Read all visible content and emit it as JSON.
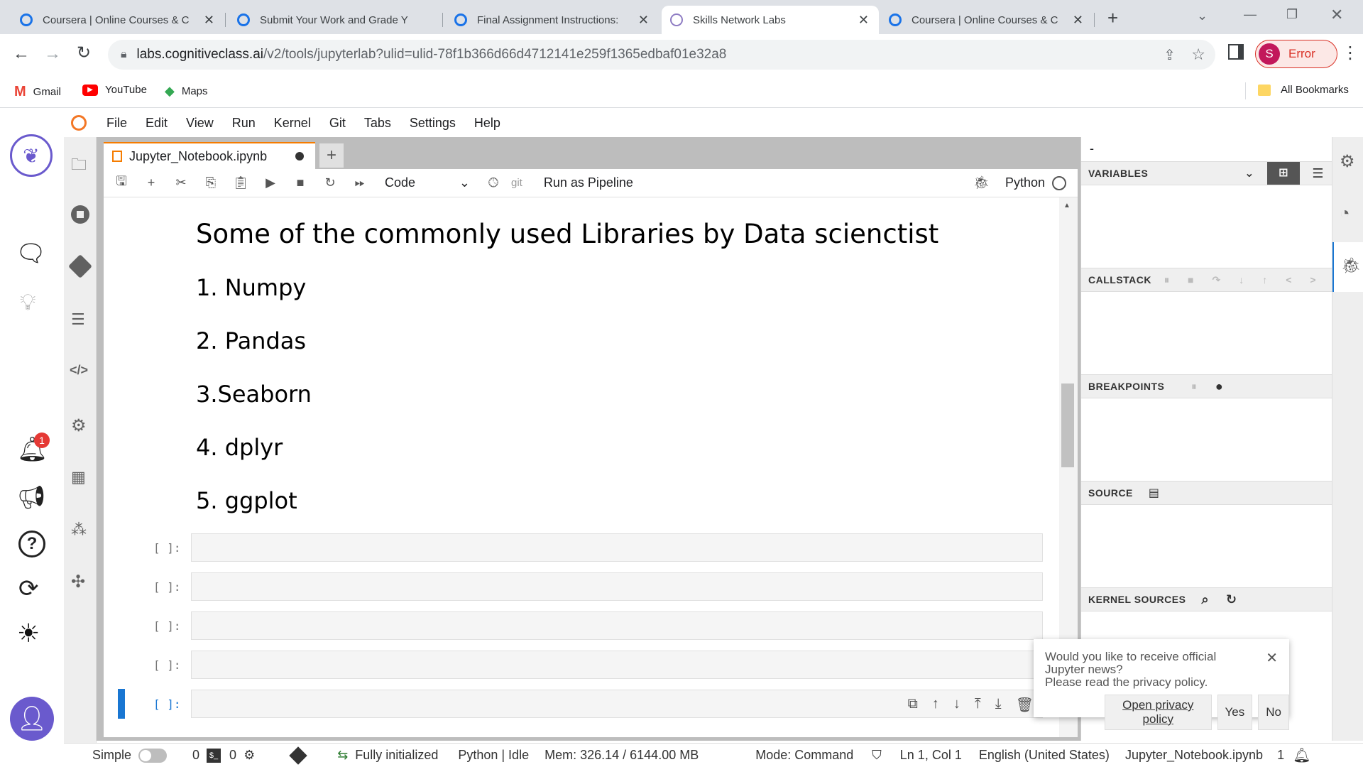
{
  "browser": {
    "tabs": [
      {
        "title": "Coursera | Online Courses & C",
        "active": false
      },
      {
        "title": "Submit Your Work and Grade Y",
        "active": false
      },
      {
        "title": "Final Assignment Instructions:",
        "active": false
      },
      {
        "title": "Skills Network Labs",
        "active": true
      },
      {
        "title": "Coursera | Online Courses & C",
        "active": false
      }
    ],
    "url_host": "labs.cognitiveclass.ai",
    "url_path": "/v2/tools/jupyterlab?ulid=ulid-78f1b366d66d4712141e259f1365edbaf01e32a8",
    "profile_initial": "S",
    "profile_status": "Error",
    "bookmarks": [
      "Gmail",
      "YouTube",
      "Maps"
    ],
    "all_bookmarks": "All Bookmarks"
  },
  "sidebar": {
    "notification_count": "1"
  },
  "menu": [
    "File",
    "Edit",
    "View",
    "Run",
    "Kernel",
    "Git",
    "Tabs",
    "Settings",
    "Help"
  ],
  "notebook": {
    "filename": "Jupyter_Notebook.ipynb",
    "cell_type": "Code",
    "git_label": "git",
    "pipeline_label": "Run as Pipeline",
    "kernel_name": "Python",
    "heading": "Some of the commonly used Libraries by Data scienctist",
    "items": [
      "1. Numpy",
      "2. Pandas",
      "3.Seaborn",
      "4. dplyr",
      "5. ggplot"
    ],
    "prompt": "[ ]:"
  },
  "debugger": {
    "top_label": "-",
    "variables": "VARIABLES",
    "callstack": "CALLSTACK",
    "breakpoints": "BREAKPOINTS",
    "source": "SOURCE",
    "kernel_sources": "KERNEL SOURCES"
  },
  "status": {
    "mode_simple": "Simple",
    "count1": "0",
    "count2": "0",
    "initialized": "Fully initialized",
    "kernel_state": "Python | Idle",
    "mem": "Mem: 326.14 / 6144.00 MB",
    "mode": "Mode: Command",
    "position": "Ln 1, Col 1",
    "language": "English (United States)",
    "file": "Jupyter_Notebook.ipynb",
    "notif_count": "1"
  },
  "notification": {
    "line1": "Would you like to receive official Jupyter news?",
    "line2": "Please read the privacy policy.",
    "privacy": "Open privacy policy",
    "yes": "Yes",
    "no": "No"
  }
}
